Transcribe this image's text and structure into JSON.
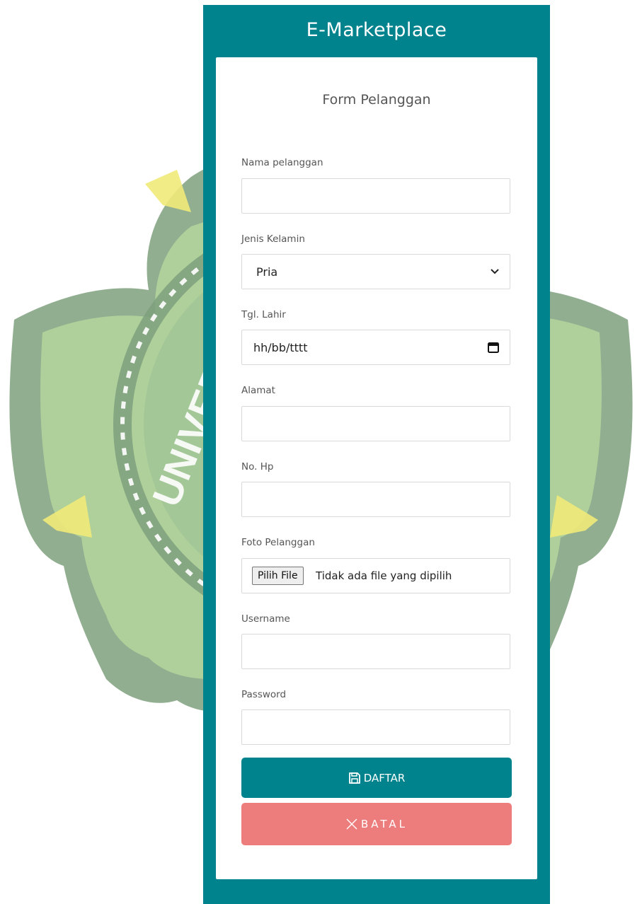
{
  "app": {
    "title": "E-Marketplace"
  },
  "watermark": {
    "text": "UNIVERSITAS"
  },
  "form": {
    "title": "Form Pelanggan",
    "fields": {
      "nama": {
        "label": "Nama pelanggan",
        "value": ""
      },
      "jenis_kelamin": {
        "label": "Jenis Kelamin",
        "value": "Pria"
      },
      "tgl_lahir": {
        "label": "Tgl. Lahir",
        "placeholder": "hh/bb/tttt"
      },
      "alamat": {
        "label": "Alamat",
        "value": ""
      },
      "no_hp": {
        "label": "No. Hp",
        "value": ""
      },
      "foto": {
        "label": "Foto Pelanggan",
        "button": "Pilih File",
        "status": "Tidak ada file yang dipilih"
      },
      "username": {
        "label": "Username",
        "value": ""
      },
      "password": {
        "label": "Password",
        "value": ""
      }
    },
    "submit": {
      "label": "DAFTAR",
      "icon": "save-icon"
    },
    "cancel": {
      "label": "BATAL",
      "icon": "close-icon"
    }
  },
  "colors": {
    "primary": "#00838d",
    "danger": "#ed7d7c",
    "watermark_green": "#7cae7d"
  }
}
